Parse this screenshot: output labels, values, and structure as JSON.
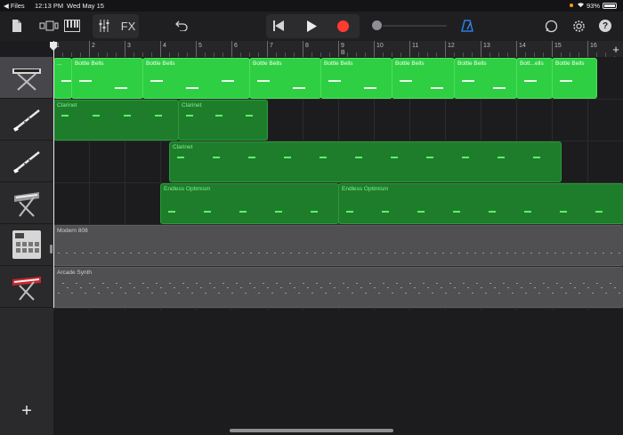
{
  "status": {
    "back_app": "◀ Files",
    "time": "12:13 PM",
    "date": "Wed May 15",
    "battery": "93%"
  },
  "toolbar": {
    "fx_label": "FX"
  },
  "ruler": {
    "bars": [
      "1",
      "2",
      "3",
      "4",
      "5",
      "6",
      "7",
      "8",
      "9",
      "10",
      "11",
      "12",
      "13",
      "14",
      "15",
      "16"
    ],
    "section_mark": "B"
  },
  "tracks": [
    {
      "name": "bells-keyboard",
      "color": "#2fcf43"
    },
    {
      "name": "clarinet-1",
      "color": "#1e7d2b"
    },
    {
      "name": "clarinet-2",
      "color": "#1e7d2b"
    },
    {
      "name": "synth-keyboard",
      "color": "#1e7d2b"
    },
    {
      "name": "drum-machine",
      "color": "#505053"
    },
    {
      "name": "arcade-synth-keyboard",
      "color": "#505053"
    }
  ],
  "regions": {
    "t0": [
      {
        "label": "...",
        "start": 0,
        "len": 0.5
      },
      {
        "label": "Bottle Bells",
        "start": 0.5,
        "len": 2
      },
      {
        "label": "Bottle Bells",
        "start": 2.5,
        "len": 3
      },
      {
        "label": "Bottle Bells",
        "start": 5.5,
        "len": 2
      },
      {
        "label": "Bottle Bells",
        "start": 7.5,
        "len": 2
      },
      {
        "label": "Bottle Bells",
        "start": 9.5,
        "len": 1.75
      },
      {
        "label": "Bottle Bells",
        "start": 11.25,
        "len": 1.75
      },
      {
        "label": "Bott...ells",
        "start": 13,
        "len": 1
      },
      {
        "label": "Bottle Bells",
        "start": 14,
        "len": 1.25
      }
    ],
    "t1": [
      {
        "label": "Clarinet",
        "start": 0,
        "len": 3.5
      },
      {
        "label": "Clarinet",
        "start": 3.5,
        "len": 2.5
      }
    ],
    "t2": [
      {
        "label": "Clarinet",
        "start": 3.25,
        "len": 11
      }
    ],
    "t3": [
      {
        "label": "Endless Optimism",
        "start": 3,
        "len": 5
      },
      {
        "label": "Endless Optimism",
        "start": 8,
        "len": 8
      }
    ],
    "t4": [
      {
        "label": "Modern 808",
        "start": 0,
        "len": 16
      }
    ],
    "t5": [
      {
        "label": "Arcade Synth",
        "start": 0,
        "len": 16
      }
    ]
  }
}
